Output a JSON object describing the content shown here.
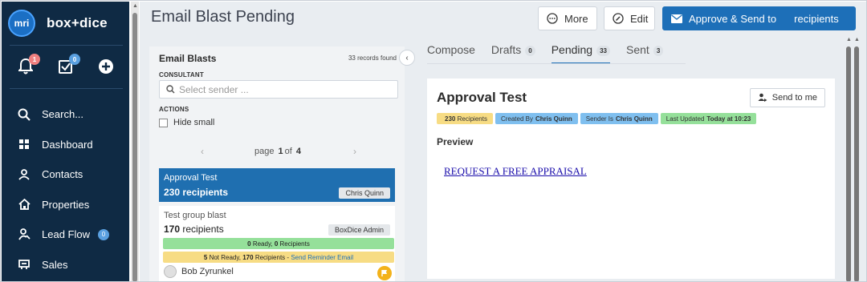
{
  "app": {
    "logo_text": "mri",
    "brand_name": "box+dice"
  },
  "quick_actions": {
    "notifications_count": "1",
    "tasks_count": "0"
  },
  "sidebar": {
    "items": [
      {
        "label": "Search..."
      },
      {
        "label": "Dashboard"
      },
      {
        "label": "Contacts"
      },
      {
        "label": "Properties"
      },
      {
        "label": "Lead Flow",
        "badge": "0"
      },
      {
        "label": "Sales"
      }
    ]
  },
  "header": {
    "title": "Email Blast Pending",
    "more_label": "More",
    "edit_label": "Edit",
    "approve_label": "Approve & Send to",
    "approve_suffix": "recipients"
  },
  "list_panel": {
    "title": "Email Blasts",
    "records_found": "33 records found",
    "consultant_label": "CONSULTANT",
    "sender_placeholder": "Select sender ...",
    "actions_label": "ACTIONS",
    "hide_small_label": "Hide small",
    "pager": {
      "prefix": "page",
      "current": "1",
      "of": "of",
      "total": "4"
    },
    "cards": [
      {
        "name": "Approval Test",
        "recipients": "230 recipients",
        "sender": "Chris Quinn"
      },
      {
        "name": "Test group blast",
        "recipients_count": "170",
        "recipients_label": "recipients",
        "sender": "BoxDice Admin",
        "ready_count": "0",
        "ready_text": "Ready,",
        "ready_recip_count": "0",
        "ready_recip_label": "Recipients",
        "notready_count": "5",
        "notready_text": "Not Ready,",
        "notready_recip_count": "170",
        "notready_recip_label": "Recipients -",
        "reminder_link": "Send Reminder Email",
        "owner": "Bob Zyrunkel"
      }
    ]
  },
  "tabs": [
    {
      "label": "Compose",
      "count": ""
    },
    {
      "label": "Drafts",
      "count": "0"
    },
    {
      "label": "Pending",
      "count": "33"
    },
    {
      "label": "Sent",
      "count": "3"
    }
  ],
  "detail": {
    "title": "Approval Test",
    "send_to_me_label": "Send to me",
    "tags": {
      "recipients_count": "230",
      "recipients_label": "Recipients",
      "created_label": "Created By",
      "created_value": "Chris Quinn",
      "sender_label": "Sender Is",
      "sender_value": "Chris Quinn",
      "updated_label": "Last Updated",
      "updated_value": "Today at 10:23"
    },
    "preview_label": "Preview",
    "preview_link": "REQUEST A FREE APPRAISAL"
  },
  "colors": {
    "sidebar_bg": "#0f2a44",
    "accent": "#1d6fb8",
    "tag_yellow": "#f7dc84",
    "tag_blue": "#7fbfef",
    "tag_green": "#95e09a"
  }
}
